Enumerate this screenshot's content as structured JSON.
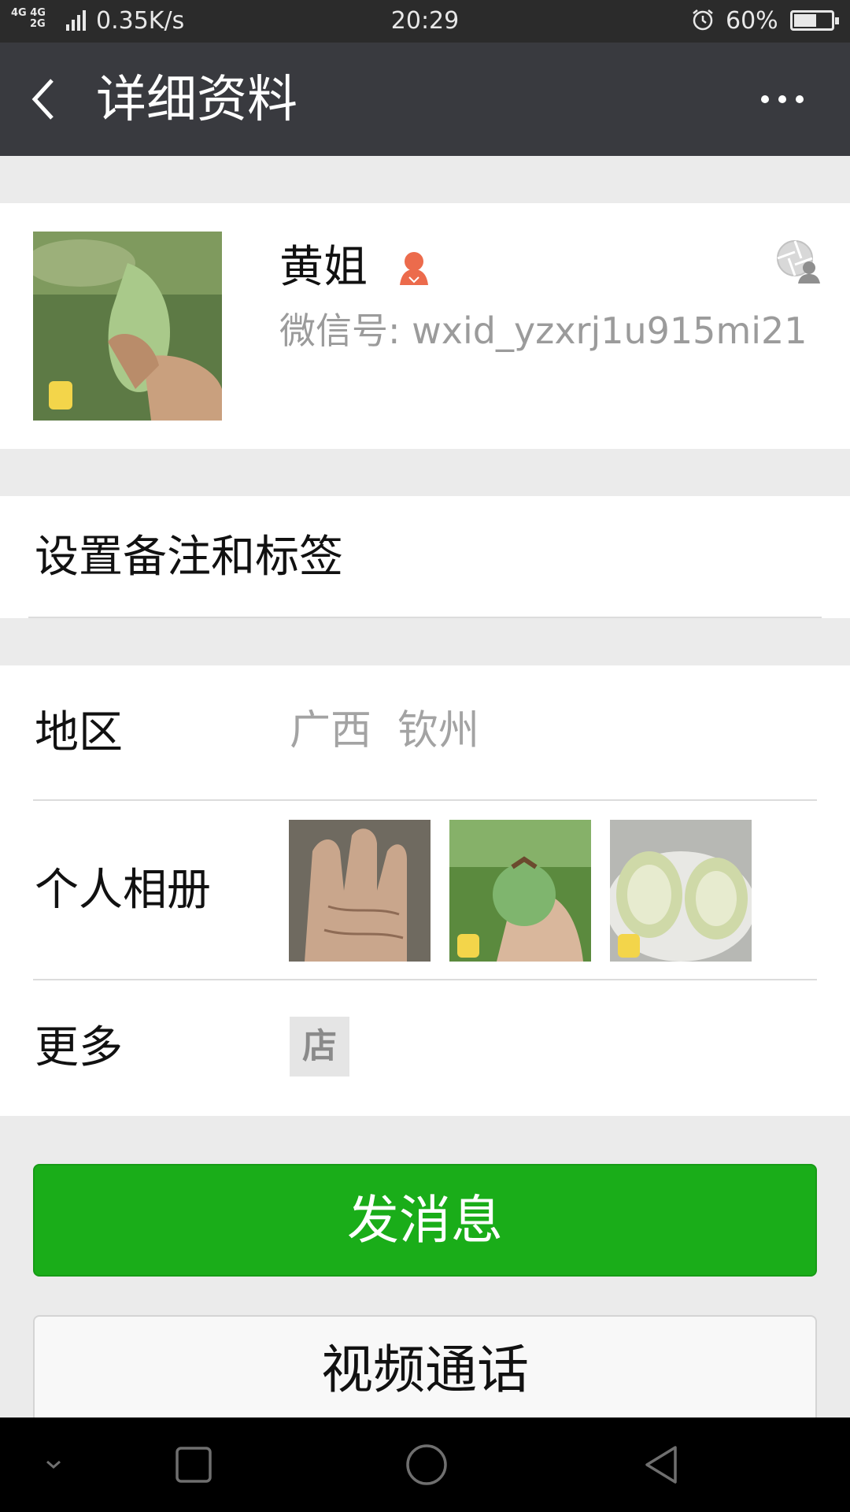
{
  "status_bar": {
    "network_top": "4G 4G",
    "network_bottom": "2G",
    "speed": "0.35K/s",
    "time": "20:29",
    "battery_pct": "60%",
    "battery_level": 0.6
  },
  "header": {
    "title": "详细资料",
    "back_icon": "chevron-left-icon",
    "more_icon": "more-dots-icon"
  },
  "profile": {
    "name": "黄姐",
    "gender_icon": "female-icon",
    "wechat_id": "微信号: wxid_yzxrj1u915mi21",
    "moments_icon": "moments-shutter-icon",
    "avatar_desc": "green-fruit-in-hand-photo"
  },
  "remark": {
    "label": "设置备注和标签"
  },
  "info": {
    "region_label": "地区",
    "region_value": "广西  钦州",
    "album_label": "个人相册",
    "album_photos": [
      "palm-photo",
      "green-fruit-photo",
      "sliced-guava-photo"
    ],
    "more_label": "更多",
    "shop_icon_text": "店"
  },
  "actions": {
    "send_message": "发消息",
    "video_call": "视频通话"
  },
  "colors": {
    "status_bar": "#2b2b2b",
    "title_bar": "#393a3f",
    "primary_green": "#1aad19",
    "background": "#ebebeb",
    "secondary_text": "#9b9b9b"
  },
  "nav_bar": {
    "icons": [
      "collapse-chevron-icon",
      "recent-apps-icon",
      "home-icon",
      "back-triangle-icon"
    ]
  }
}
